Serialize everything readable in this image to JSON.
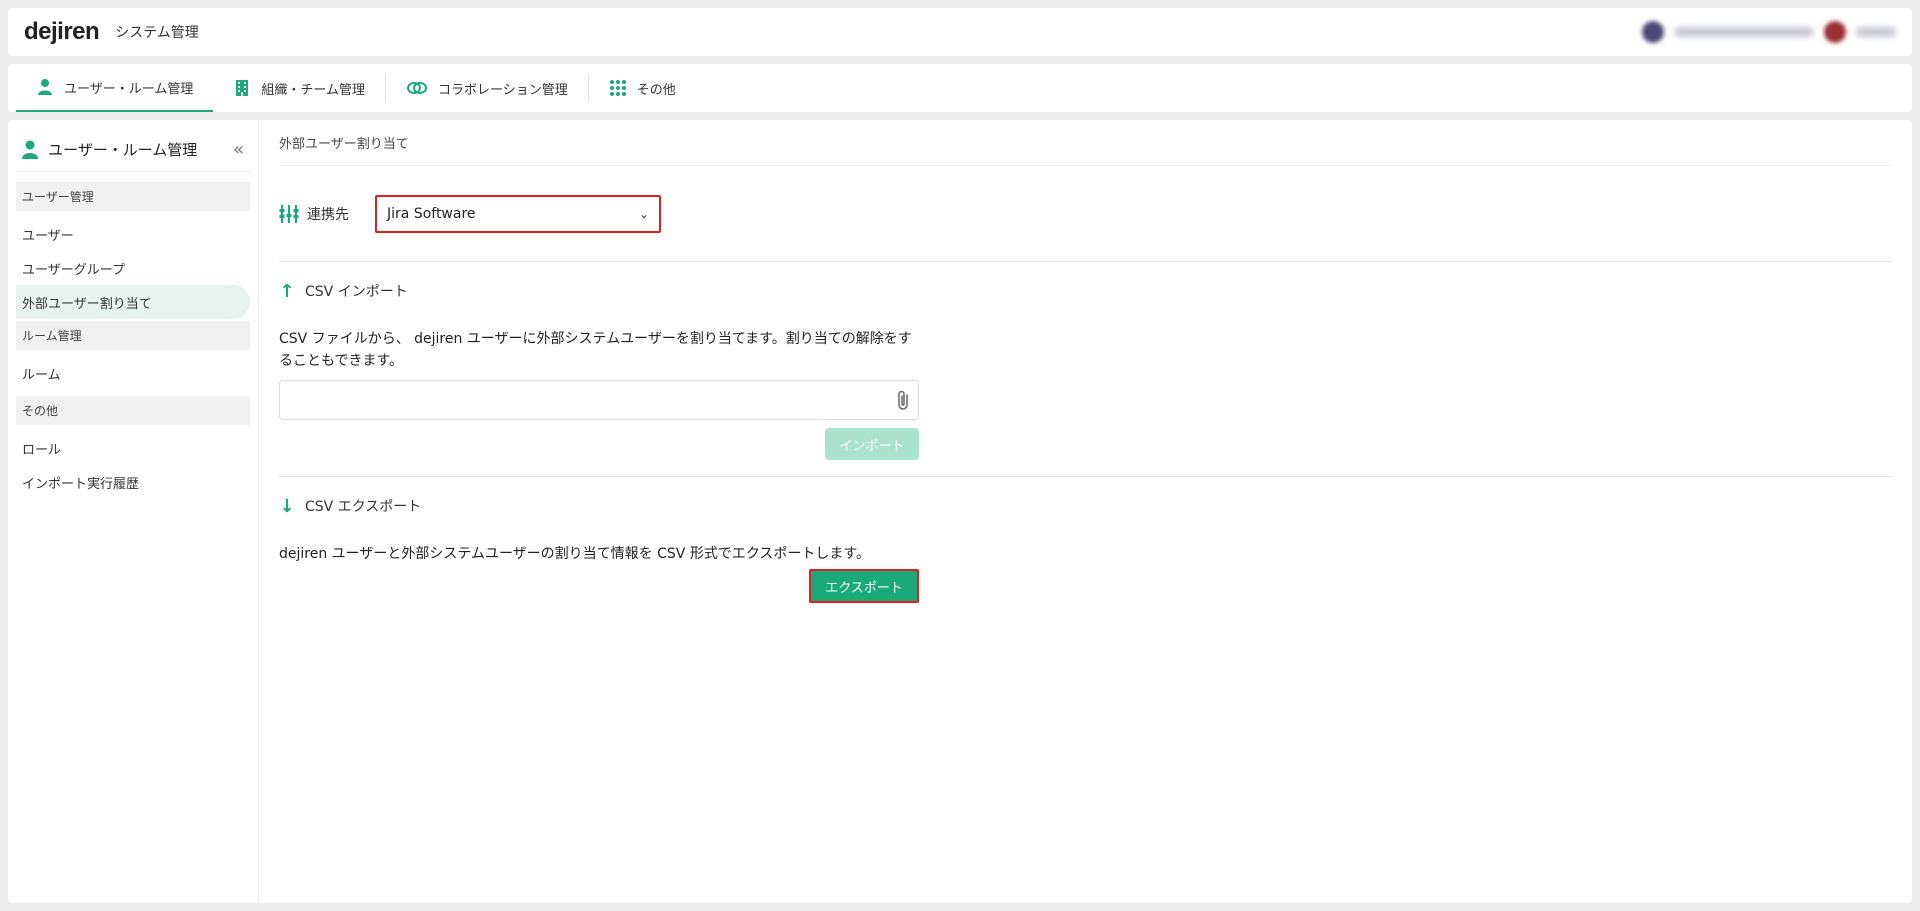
{
  "topbar": {
    "logo": "dejiren",
    "app_title": "システム管理",
    "user_avatar_color": "#4a4a7a",
    "org_avatar_color": "#9a2f34"
  },
  "navbar": {
    "tabs": [
      {
        "label": "ユーザー・ルーム管理",
        "icon": "person-icon",
        "active": true
      },
      {
        "label": "組織・チーム管理",
        "icon": "building-icon",
        "active": false
      },
      {
        "label": "コラボレーション管理",
        "icon": "link-icon",
        "active": false
      },
      {
        "label": "その他",
        "icon": "grid-icon",
        "active": false
      }
    ]
  },
  "sidebar": {
    "title": "ユーザー・ルーム管理",
    "collapse_icon": "double-chevron-left-icon",
    "sections": [
      {
        "header": "ユーザー管理",
        "items": [
          "ユーザー",
          "ユーザーグループ",
          "外部ユーザー割り当て"
        ]
      },
      {
        "header": "ルーム管理",
        "items": [
          "ルーム"
        ]
      },
      {
        "header": "その他",
        "items": [
          "ロール",
          "インポート実行履歴"
        ]
      }
    ],
    "active_item": "外部ユーザー割り当て"
  },
  "main": {
    "breadcrumb": "外部ユーザー割り当て",
    "link_label": "連携先",
    "link_icon": "sliders-icon",
    "select_value": "Jira Software",
    "import": {
      "title": "CSV インポート",
      "description": "CSV ファイルから、 dejiren ユーザーに外部システムユーザーを割り当てます。割り当ての解除をすることもできます。",
      "attach_icon": "paperclip-icon",
      "button": "インポート"
    },
    "export": {
      "title": "CSV エクスポート",
      "description": "dejiren ユーザーと外部システムユーザーの割り当て情報を CSV 形式でエクスポートします。",
      "button": "エクスポート"
    }
  },
  "colors": {
    "accent": "#1aaa7a",
    "highlight_border": "#e02020",
    "disabled_button": "#a9e3cd"
  }
}
